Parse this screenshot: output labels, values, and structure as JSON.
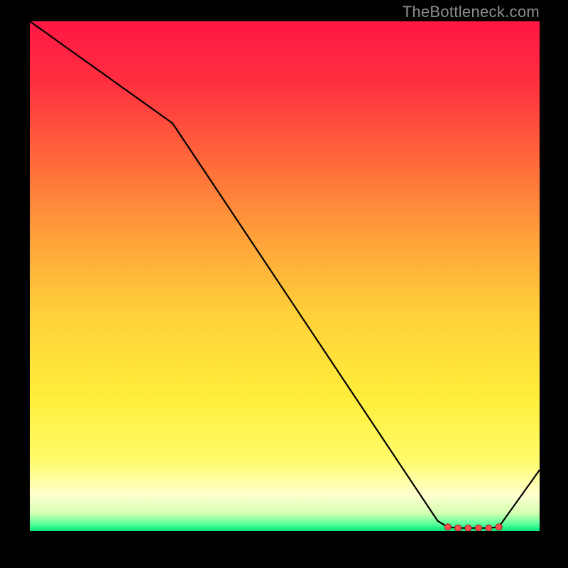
{
  "attribution": "TheBottleneck.com",
  "chart_data": {
    "type": "line",
    "title": "",
    "xlabel": "",
    "ylabel": "",
    "xlim": [
      0,
      100
    ],
    "ylim": [
      0,
      100
    ],
    "grid": false,
    "x": [
      0,
      28,
      80,
      82,
      84,
      86,
      88,
      90,
      92,
      100
    ],
    "values": [
      100,
      80,
      2,
      0.8,
      0.6,
      0.6,
      0.6,
      0.6,
      0.8,
      12
    ],
    "markers": {
      "x": [
        82,
        84,
        86,
        88,
        90,
        92
      ],
      "y": [
        0.8,
        0.6,
        0.6,
        0.6,
        0.6,
        0.8
      ]
    },
    "gradient_stops": [
      {
        "offset": 0.0,
        "color": "#ff1744"
      },
      {
        "offset": 0.12,
        "color": "#ff2f3f"
      },
      {
        "offset": 0.28,
        "color": "#ff6b3a"
      },
      {
        "offset": 0.42,
        "color": "#ffa03a"
      },
      {
        "offset": 0.58,
        "color": "#ffd23a"
      },
      {
        "offset": 0.74,
        "color": "#ffee3a"
      },
      {
        "offset": 0.86,
        "color": "#fffc6a"
      },
      {
        "offset": 0.93,
        "color": "#ffffd0"
      },
      {
        "offset": 0.965,
        "color": "#d4ffb0"
      },
      {
        "offset": 0.985,
        "color": "#5fff9e"
      },
      {
        "offset": 1.0,
        "color": "#00e676"
      }
    ],
    "line_color": "#000000",
    "marker_fill": "#ff4d4d",
    "marker_stroke": "#9c2020"
  }
}
